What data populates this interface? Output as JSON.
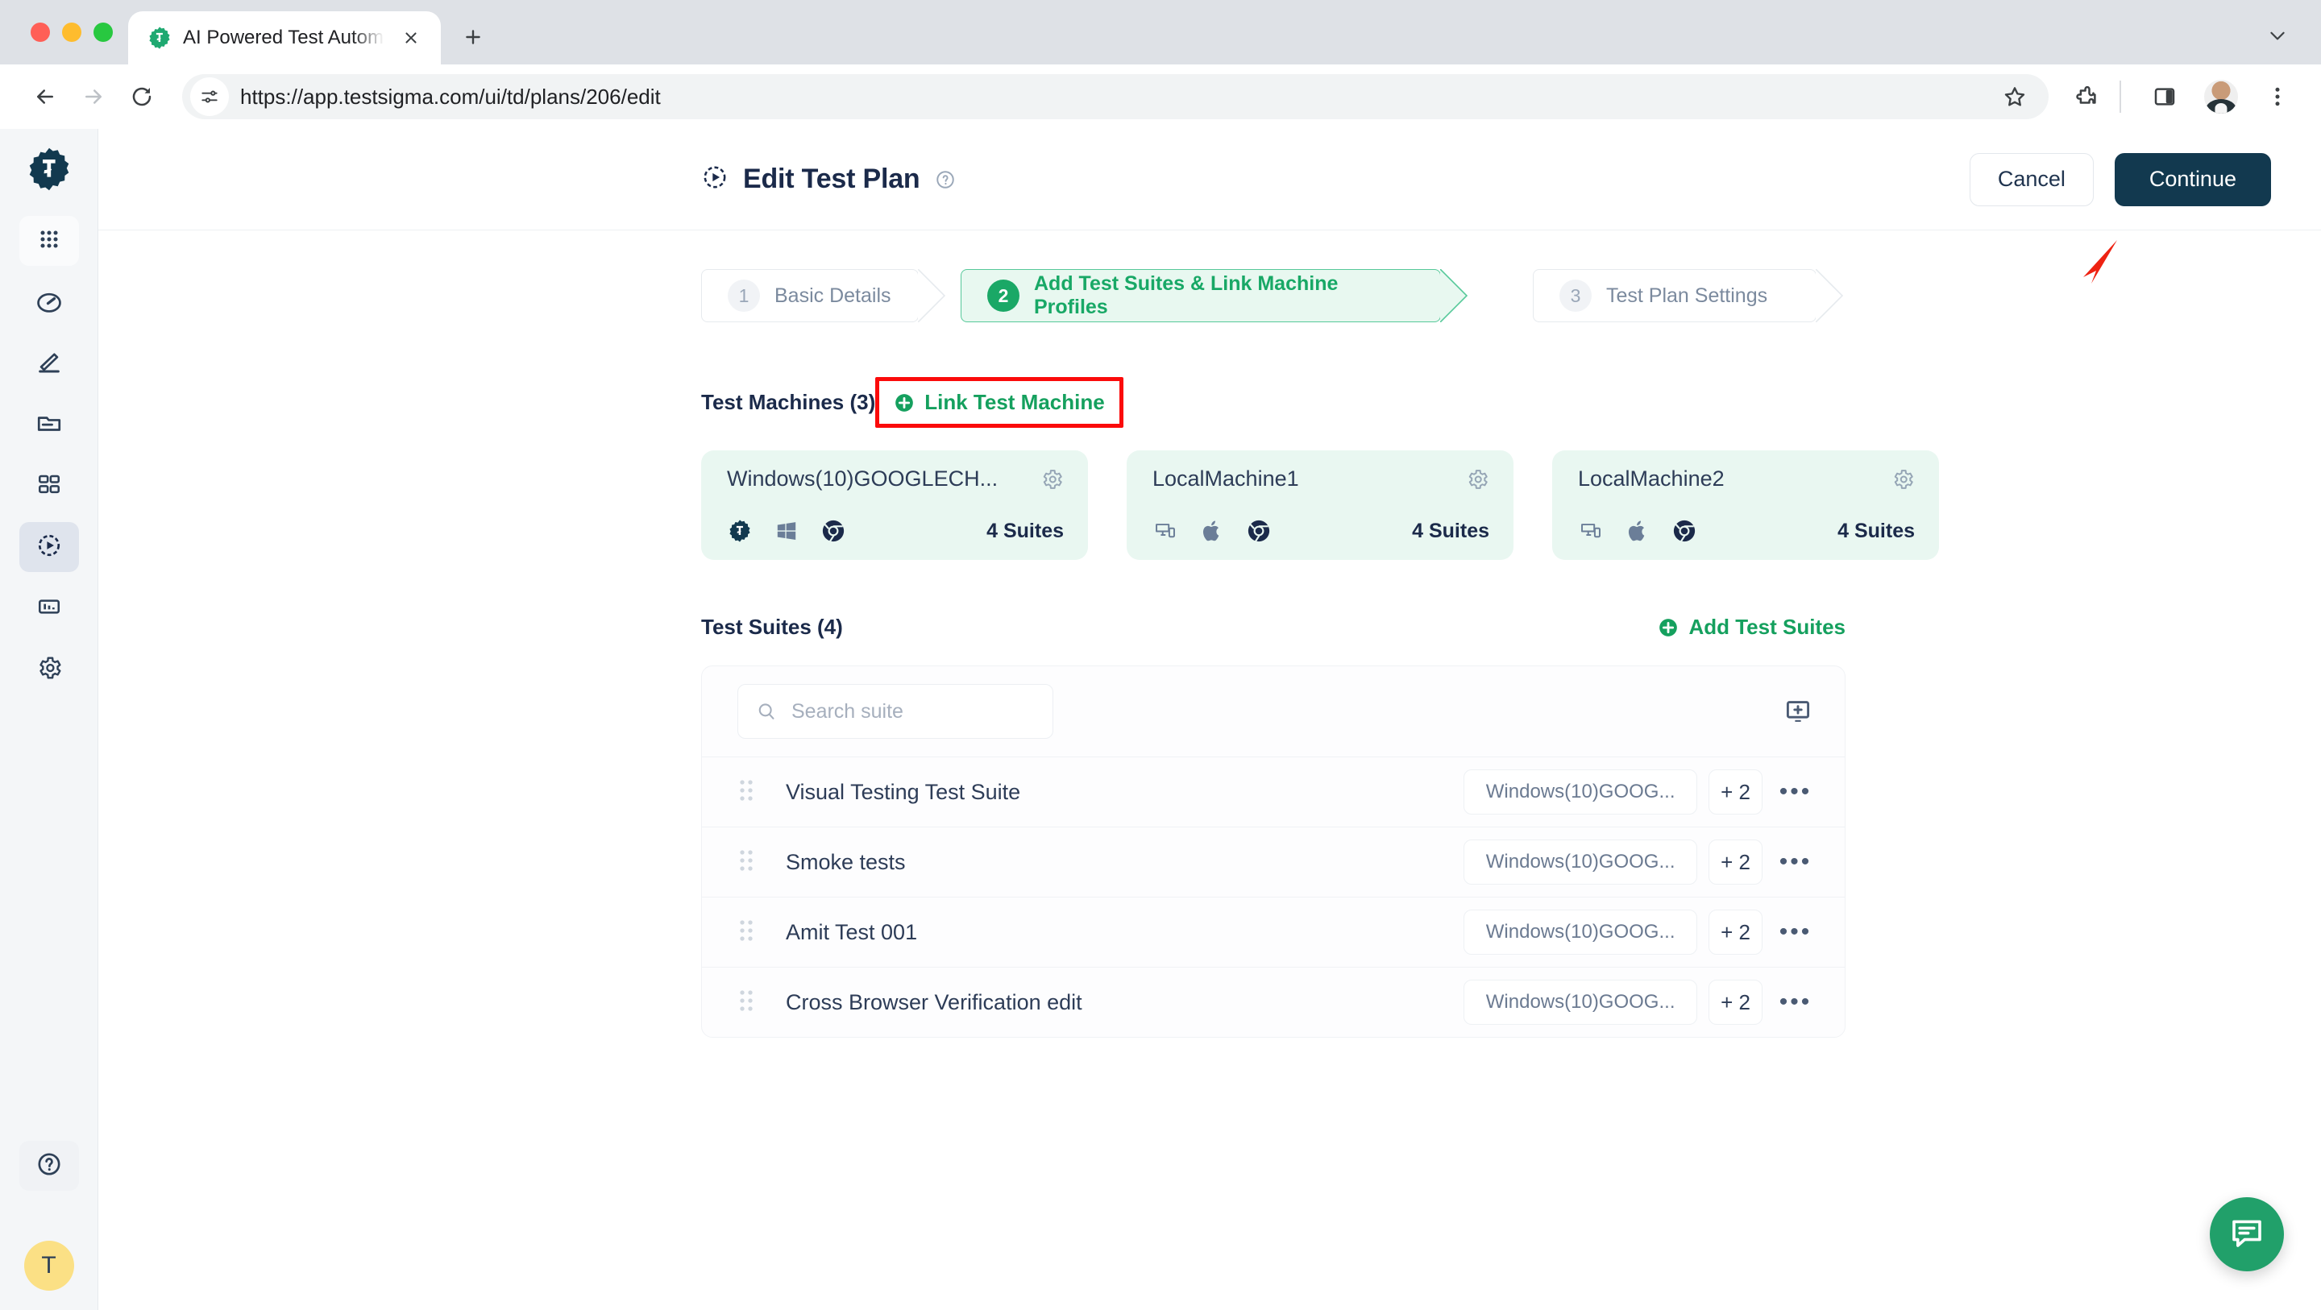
{
  "browser": {
    "tab": {
      "title": "AI Powered Test Automation P",
      "favicon": "testsigma-gear-icon"
    },
    "new_tab_label": "+",
    "url": "https://app.testsigma.com/ui/td/plans/206/edit",
    "back_icon": "back-arrow-icon",
    "forward_icon": "forward-arrow-icon",
    "reload_icon": "reload-icon",
    "site_info_icon": "site-settings-icon",
    "bookmark_icon": "star-icon",
    "extensions_icon": "extensions-puzzle-icon",
    "sidepanel_icon": "side-panel-icon",
    "profile_icon": "profile-avatar",
    "menu_icon": "three-dot-menu-icon",
    "tabstrip_menu_icon": "chevron-down-icon"
  },
  "sidebar": {
    "logo": "testsigma-logo",
    "items": [
      {
        "name": "apps-grid",
        "icon": "grid-dots-icon",
        "active": false,
        "soft": true
      },
      {
        "name": "dashboard",
        "icon": "speedometer-icon",
        "active": false,
        "soft": false
      },
      {
        "name": "create",
        "icon": "pencil-icon",
        "active": false,
        "soft": false
      },
      {
        "name": "test-cases",
        "icon": "folder-icon",
        "active": false,
        "soft": false
      },
      {
        "name": "test-suites",
        "icon": "squares-icon",
        "active": false,
        "soft": false
      },
      {
        "name": "test-plans",
        "icon": "play-circle-icon",
        "active": true,
        "soft": false
      },
      {
        "name": "reports",
        "icon": "bar-chart-icon",
        "active": false,
        "soft": false
      },
      {
        "name": "settings",
        "icon": "gear-icon",
        "active": false,
        "soft": false
      }
    ],
    "help_icon": "question-circle-icon",
    "user_initial": "T"
  },
  "header": {
    "icon": "play-circle-icon",
    "title": "Edit Test Plan",
    "help_icon": "help-circle-icon",
    "cancel_label": "Cancel",
    "continue_label": "Continue"
  },
  "stepper": {
    "steps": [
      {
        "num": "1",
        "label": "Basic Details",
        "active": false
      },
      {
        "num": "2",
        "label": "Add Test Suites & Link Machine Profiles",
        "active": true
      },
      {
        "num": "3",
        "label": "Test Plan Settings",
        "active": false
      }
    ],
    "annotation_cursor": "red-arrow-cursor"
  },
  "machines_section": {
    "title": "Test Machines (3)",
    "action_label": "Link Test Machine",
    "action_icon": "plus-circle-icon",
    "action_highlighted": true,
    "cards": [
      {
        "name": "Windows(10)GOOGLECH...",
        "gear_icon": "gear-icon",
        "platform_icons": [
          "testsigma-gear-icon",
          "windows-icon",
          "chrome-icon"
        ],
        "suites": "4 Suites"
      },
      {
        "name": "LocalMachine1",
        "gear_icon": "gear-icon",
        "platform_icons": [
          "devices-icon",
          "apple-icon",
          "chrome-icon"
        ],
        "suites": "4 Suites"
      },
      {
        "name": "LocalMachine2",
        "gear_icon": "gear-icon",
        "platform_icons": [
          "devices-icon",
          "apple-icon",
          "chrome-icon"
        ],
        "suites": "4 Suites"
      }
    ]
  },
  "suites_section": {
    "title": "Test Suites (4)",
    "action_label": "Add Test Suites",
    "action_icon": "plus-circle-icon",
    "search_placeholder": "Search suite",
    "search_value": "",
    "search_icon": "search-icon",
    "panel_action_icon": "add-screen-icon",
    "rows": [
      {
        "name": "Visual Testing Test Suite",
        "machine": "Windows(10)GOOG...",
        "extra": "+ 2",
        "menu": "•••"
      },
      {
        "name": "Smoke tests",
        "machine": "Windows(10)GOOG...",
        "extra": "+ 2",
        "menu": "•••"
      },
      {
        "name": "Amit Test 001",
        "machine": "Windows(10)GOOG...",
        "extra": "+ 2",
        "menu": "•••"
      },
      {
        "name": "Cross Browser Verification edit",
        "machine": "Windows(10)GOOG...",
        "extra": "+ 2",
        "menu": "•••"
      }
    ]
  },
  "chat": {
    "icon": "chat-bubble-icon"
  },
  "colors": {
    "brand_dark": "#12394f",
    "accent_green": "#15a05e",
    "step_active_bg": "#e8f8f0",
    "machine_card_bg": "#e9f7f1",
    "highlight_red": "#fb0b0b",
    "text_dark": "#1b2a4a",
    "avatar_yellow": "#fbe085"
  }
}
